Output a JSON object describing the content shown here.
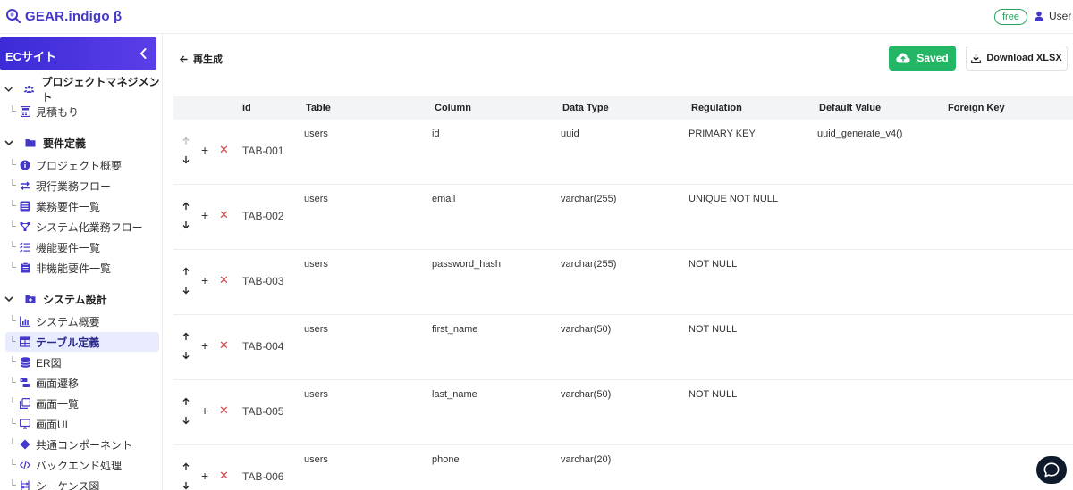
{
  "app": {
    "logo_text": "GEAR.indigo β",
    "plan_badge": "free",
    "user_label": "User"
  },
  "sidebar": {
    "project_name": "ECサイト",
    "sections": [
      {
        "label": "プロジェクトマネジメント",
        "items": [
          {
            "label": "見積もり"
          }
        ]
      },
      {
        "label": "要件定義",
        "items": [
          {
            "label": "プロジェクト概要"
          },
          {
            "label": "現行業務フロー"
          },
          {
            "label": "業務要件一覧"
          },
          {
            "label": "システム化業務フロー"
          },
          {
            "label": "機能要件一覧"
          },
          {
            "label": "非機能要件一覧"
          }
        ]
      },
      {
        "label": "システム設計",
        "items": [
          {
            "label": "システム概要"
          },
          {
            "label": "テーブル定義",
            "active": true
          },
          {
            "label": "ER図"
          },
          {
            "label": "画面遷移"
          },
          {
            "label": "画面一覧"
          },
          {
            "label": "画面UI"
          },
          {
            "label": "共通コンポーネント"
          },
          {
            "label": "バックエンド処理"
          },
          {
            "label": "シーケンス図"
          }
        ]
      }
    ]
  },
  "toolbar": {
    "back_label": "再生成",
    "saved_label": "Saved",
    "download_label": "Download XLSX"
  },
  "table": {
    "columns": [
      "id",
      "Table",
      "Column",
      "Data Type",
      "Regulation",
      "Default Value",
      "Foreign Key"
    ],
    "rows": [
      {
        "id": "TAB-001",
        "table": "users",
        "column": "id",
        "data_type": "uuid",
        "regulation": "PRIMARY KEY",
        "default_value": "uuid_generate_v4()",
        "foreign_key": ""
      },
      {
        "id": "TAB-002",
        "table": "users",
        "column": "email",
        "data_type": "varchar(255)",
        "regulation": "UNIQUE NOT NULL",
        "default_value": "",
        "foreign_key": ""
      },
      {
        "id": "TAB-003",
        "table": "users",
        "column": "password_hash",
        "data_type": "varchar(255)",
        "regulation": "NOT NULL",
        "default_value": "",
        "foreign_key": ""
      },
      {
        "id": "TAB-004",
        "table": "users",
        "column": "first_name",
        "data_type": "varchar(50)",
        "regulation": "NOT NULL",
        "default_value": "",
        "foreign_key": ""
      },
      {
        "id": "TAB-005",
        "table": "users",
        "column": "last_name",
        "data_type": "varchar(50)",
        "regulation": "NOT NULL",
        "default_value": "",
        "foreign_key": ""
      },
      {
        "id": "TAB-006",
        "table": "users",
        "column": "phone",
        "data_type": "varchar(20)",
        "regulation": "",
        "default_value": "",
        "foreign_key": ""
      }
    ]
  },
  "colors": {
    "brand": "#4338ca",
    "saved_green": "#22b665",
    "delete_red": "#e24646",
    "active_bg": "#e9ecff"
  }
}
